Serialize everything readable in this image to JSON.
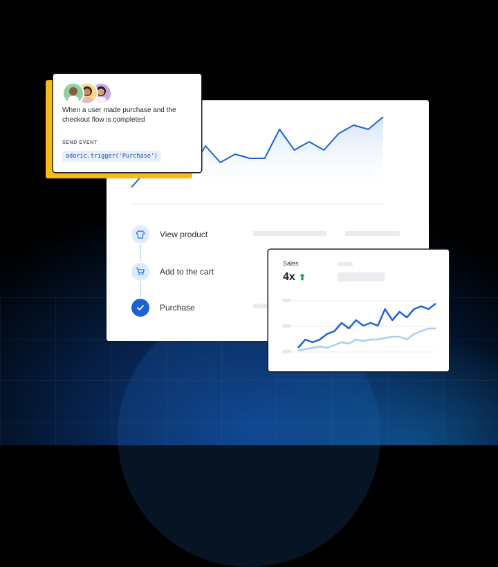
{
  "event_card": {
    "description": "When a user made purchase and the checkout flow is completed",
    "label": "SEND EVENT",
    "code": "adoric.trigger('Purchase')"
  },
  "steps": [
    {
      "label": "View product",
      "icon": "shirt-icon",
      "state": "pending"
    },
    {
      "label": "Add to the cart",
      "icon": "cart-icon",
      "state": "pending"
    },
    {
      "label": "Purchase",
      "icon": "check-icon",
      "state": "done"
    }
  ],
  "sales_card": {
    "label": "Sales",
    "value": "4x",
    "trend_icon": "arrow-up-icon"
  },
  "colors": {
    "accent_blue": "#1b63d4",
    "highlight_yellow": "#f7bb17",
    "trend_green": "#1f9d55"
  },
  "chart_data": [
    {
      "type": "area",
      "series": [
        {
          "values": [
            2,
            6,
            5,
            5,
            6,
            12,
            8,
            10,
            9,
            9,
            16,
            11,
            13,
            11,
            15,
            17,
            16,
            19
          ]
        }
      ],
      "ylim": [
        0,
        20
      ],
      "grid": false
    },
    {
      "type": "line",
      "series": [
        {
          "values": [
            2,
            5,
            4,
            5,
            7,
            8,
            11,
            9,
            12,
            10,
            11,
            10,
            16,
            12,
            15,
            13,
            16,
            17,
            16,
            18
          ]
        },
        {
          "values": [
            1,
            1.5,
            2,
            2.5,
            2,
            3,
            4,
            3.5,
            5,
            4.5,
            5,
            5,
            5.5,
            6,
            6,
            5,
            7,
            8,
            9,
            9
          ]
        }
      ],
      "ylim": [
        0,
        20
      ],
      "grid": true
    }
  ]
}
